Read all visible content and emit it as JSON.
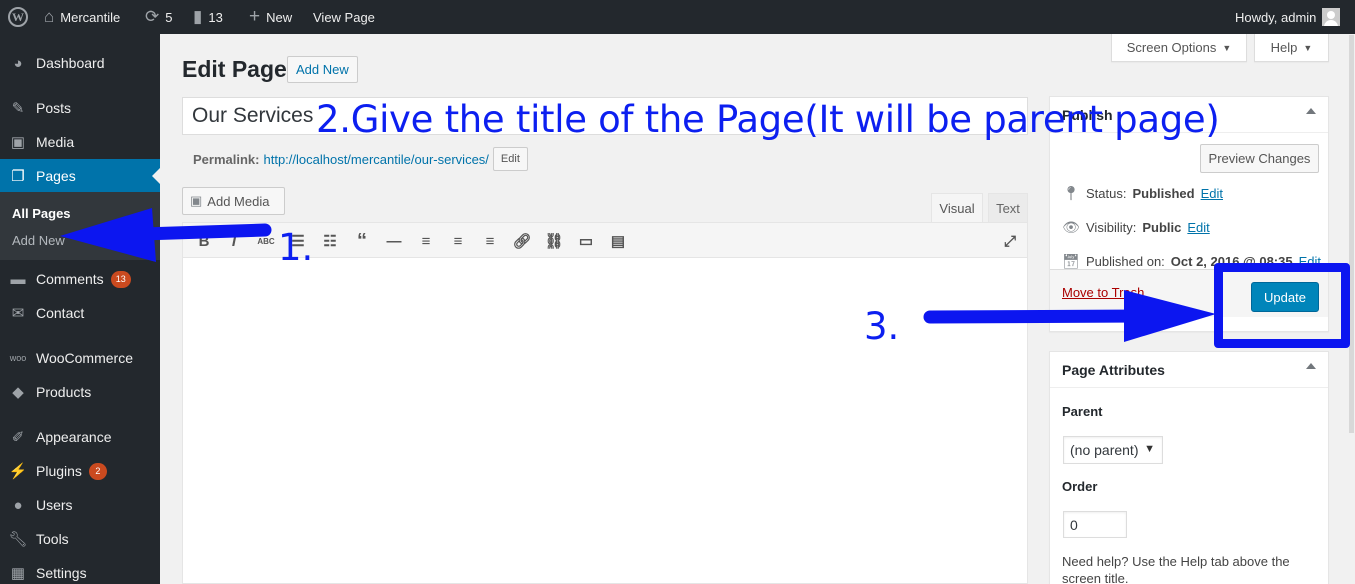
{
  "adminbar": {
    "wp_logo": "W",
    "site_name": "Mercantile",
    "updates_count": "5",
    "comments_count": "13",
    "new_label": "New",
    "view_page_label": "View Page",
    "howdy": "Howdy, admin"
  },
  "sidebar": {
    "items": [
      {
        "label": "Dashboard",
        "icon": "dashboard-icon"
      },
      {
        "label": "Posts",
        "icon": "pin-icon"
      },
      {
        "label": "Media",
        "icon": "media-icon"
      },
      {
        "label": "Pages",
        "icon": "pages-icon"
      },
      {
        "label": "Comments",
        "icon": "comment-icon",
        "badge": "13"
      },
      {
        "label": "Contact",
        "icon": "mail-icon"
      },
      {
        "label": "WooCommerce",
        "icon": "woo-icon"
      },
      {
        "label": "Products",
        "icon": "box-icon"
      },
      {
        "label": "Appearance",
        "icon": "brush-icon"
      },
      {
        "label": "Plugins",
        "icon": "plug-icon",
        "badge": "2"
      },
      {
        "label": "Users",
        "icon": "user-icon"
      },
      {
        "label": "Tools",
        "icon": "wrench-icon"
      },
      {
        "label": "Settings",
        "icon": "settings-icon"
      }
    ],
    "submenu": {
      "all_pages": "All Pages",
      "add_new": "Add New"
    }
  },
  "tabs": {
    "screen_options": "Screen Options",
    "help": "Help"
  },
  "heading": {
    "title": "Edit Page",
    "add_new": "Add New"
  },
  "editor": {
    "title_value": "Our Services",
    "permalink_label": "Permalink:",
    "permalink_url": "http://localhost/mercantile/our-services/",
    "permalink_edit": "Edit",
    "add_media": "Add Media",
    "tab_visual": "Visual",
    "tab_text": "Text"
  },
  "publish": {
    "title": "Publish",
    "preview": "Preview Changes",
    "status_label": "Status:",
    "status_value": "Published",
    "status_edit": "Edit",
    "visibility_label": "Visibility:",
    "visibility_value": "Public",
    "visibility_edit": "Edit",
    "published_label": "Published on:",
    "published_value": "Oct 2, 2016 @ 08:35",
    "published_edit": "Edit",
    "trash": "Move to Trash",
    "update": "Update"
  },
  "page_attributes": {
    "title": "Page Attributes",
    "parent_label": "Parent",
    "parent_value": "(no parent)",
    "order_label": "Order",
    "order_value": "0",
    "help_text": "Need help? Use the Help tab above the screen title."
  },
  "annotations": {
    "step1": "1.",
    "step2": "2.Give the title of the Page(It will be parent page)",
    "step3": "3.",
    "color": "#0c1ff0"
  }
}
